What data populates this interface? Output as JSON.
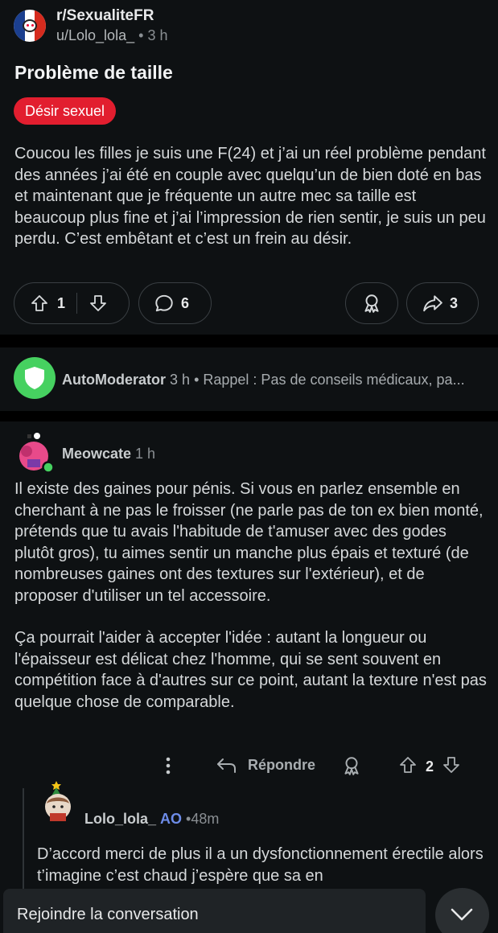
{
  "post": {
    "subreddit": "r/SexualiteFR",
    "author": "u/Lolo_lola_",
    "separator": "•",
    "time": "3 h",
    "title": "Problème de taille",
    "flair": "Désir sexuel",
    "flair_color": "#e21e2f",
    "body": "Coucou les filles je suis une F(24) et j’ai un réel problème pendant des années j’ai été en couple avec quelqu’un de bien doté en bas et maintenant que je fréquente un autre mec sa taille est beaucoup plus fine et j’ai l’impression de rien sentir, je suis un peu perdu. C’est embêtant et c’est un frein au désir.",
    "votes": "1",
    "comments": "6",
    "shares": "3"
  },
  "automod": {
    "name": "AutoModerator",
    "time": "3 h",
    "separator": "•",
    "preview": "Rappel : Pas de conseils médicaux, pa..."
  },
  "comment": {
    "author": "Meowcate",
    "time": "1 h",
    "paragraph1": "Il existe des gaines pour pénis. Si vous en parlez ensemble en cherchant à ne pas le froisser (ne parle pas de ton ex bien monté, prétends que tu avais l'habitude de t'amuser avec des godes plutôt gros), tu aimes sentir un manche plus épais et texturé (de nombreuses gaines ont des textures sur l'extérieur), et de proposer d'utiliser un tel accessoire.",
    "paragraph2": "Ça pourrait l'aider à accepter l'idée : autant la longueur ou l'épaisseur est délicat chez l'homme, qui se sent souvent en compétition face à d'autres sur ce point, autant la texture n'est pas quelque chose de comparable.",
    "more_icon": "more-vertical-icon",
    "reply_label": "Répondre",
    "votes": "2",
    "online_color": "#46d160"
  },
  "reply": {
    "author": "Lolo_lola_",
    "op_badge": "AO",
    "separator": "•",
    "time": "48m",
    "text": "D’accord merci de plus il a un dysfonctionnement érectile alors t’imagine c’est chaud j’espère que sa en"
  },
  "footer": {
    "join_label": "Rejoindre la conversation",
    "collapse_icon": "chevron-down-icon"
  }
}
